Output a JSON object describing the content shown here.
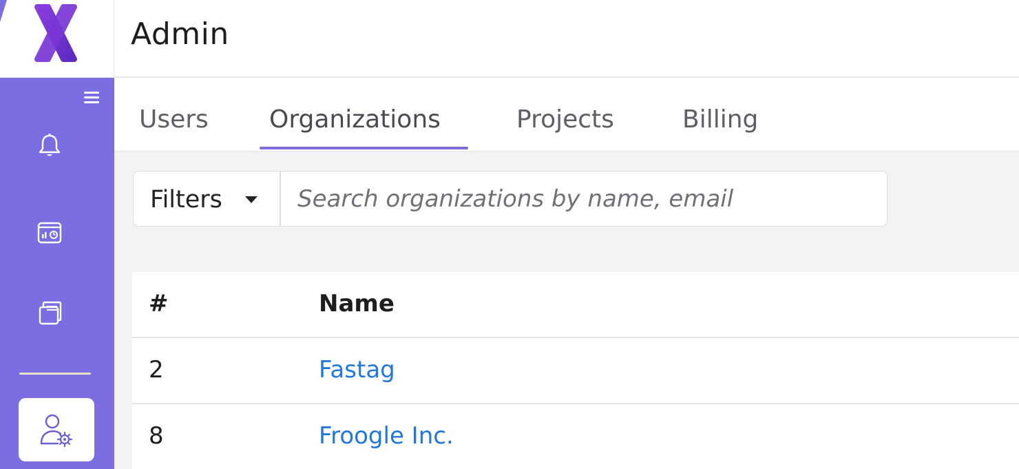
{
  "app": {
    "logo_icon": "x-logo-icon",
    "page_title": "Admin",
    "accent_color": "#7b6ee0",
    "link_color": "#2277dd"
  },
  "sidebar": {
    "items": [
      {
        "icon": "hamburger-menu-icon"
      },
      {
        "icon": "bell-icon"
      },
      {
        "icon": "dashboard-chart-icon"
      },
      {
        "icon": "documents-icon"
      },
      {
        "icon": "user-settings-icon",
        "active": true
      }
    ]
  },
  "tabs": [
    {
      "label": "Users"
    },
    {
      "label": "Organizations",
      "active": true
    },
    {
      "label": "Projects"
    },
    {
      "label": "Billing"
    }
  ],
  "search": {
    "filters_label": "Filters",
    "placeholder": "Search organizations by name, email",
    "value": ""
  },
  "table": {
    "headers": {
      "num": "#",
      "name": "Name"
    },
    "rows": [
      {
        "num": "2",
        "name": "Fastag"
      },
      {
        "num": "8",
        "name": "Froogle Inc."
      }
    ]
  }
}
